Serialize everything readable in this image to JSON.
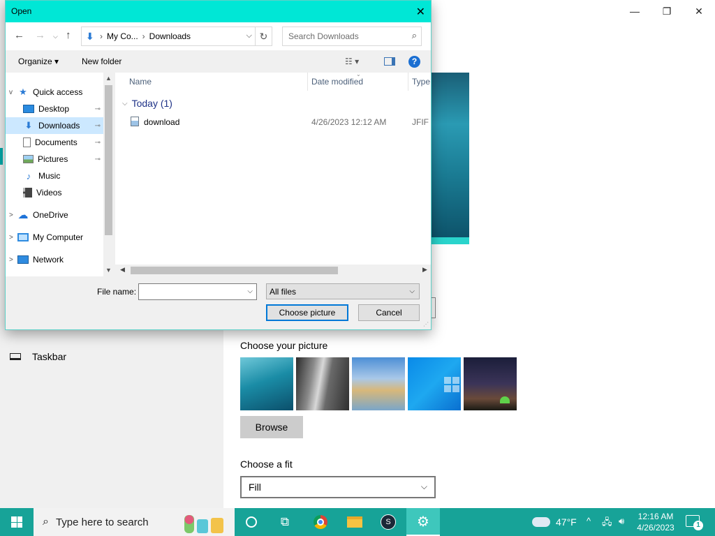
{
  "settings": {
    "window_controls": {
      "minimize": "—",
      "maximize": "❐",
      "close": "✕"
    },
    "nav": {
      "taskbar_label": "Taskbar"
    },
    "choose_picture_label": "Choose your picture",
    "thumbnails": [
      "underwater-swimmer",
      "rock-cliff",
      "beach-rocks",
      "windows-blue",
      "night-sky-tent"
    ],
    "browse_label": "Browse",
    "choose_fit_label": "Choose a fit",
    "fit_value": "Fill"
  },
  "dialog": {
    "title": "Open",
    "close_glyph": "✕",
    "address": {
      "crumbs": [
        "My Co...",
        "Downloads"
      ]
    },
    "search_placeholder": "Search Downloads",
    "toolbar": {
      "organize": "Organize ▾",
      "new_folder": "New folder",
      "help": "?"
    },
    "nav_pane": {
      "items": [
        {
          "label": "Quick access",
          "icon": "star-icon",
          "expander": "v"
        },
        {
          "label": "Desktop",
          "icon": "desktop-icon",
          "pinned": true
        },
        {
          "label": "Downloads",
          "icon": "download-arrow-icon",
          "pinned": true,
          "selected": true
        },
        {
          "label": "Documents",
          "icon": "document-icon",
          "pinned": true
        },
        {
          "label": "Pictures",
          "icon": "pictures-icon",
          "pinned": true
        },
        {
          "label": "Music",
          "icon": "music-icon"
        },
        {
          "label": "Videos",
          "icon": "videos-icon"
        },
        {
          "label": "OneDrive",
          "icon": "cloud-icon",
          "expander": ">"
        },
        {
          "label": "My Computer",
          "icon": "computer-icon",
          "expander": ">"
        },
        {
          "label": "Network",
          "icon": "network-icon",
          "expander": ">"
        }
      ]
    },
    "columns": {
      "name": "Name",
      "date": "Date modified",
      "type": "Type"
    },
    "group": {
      "label": "Today (1)"
    },
    "files": [
      {
        "name": "download",
        "date": "4/26/2023 12:12 AM",
        "type": "JFIF F"
      }
    ],
    "file_name_label": "File name:",
    "file_name_value": "",
    "file_type_value": "All files",
    "choose_button": "Choose picture",
    "cancel_button": "Cancel"
  },
  "taskbar": {
    "search_placeholder": "Type here to search",
    "weather": "47°F",
    "clock_time": "12:16 AM",
    "clock_date": "4/26/2023",
    "notification_count": "1",
    "steam_glyph": "S"
  },
  "colors": {
    "accent": "#00e7d6",
    "taskbar": "#17a398",
    "selection": "#cce8ff",
    "primary_button_border": "#0078d7"
  }
}
